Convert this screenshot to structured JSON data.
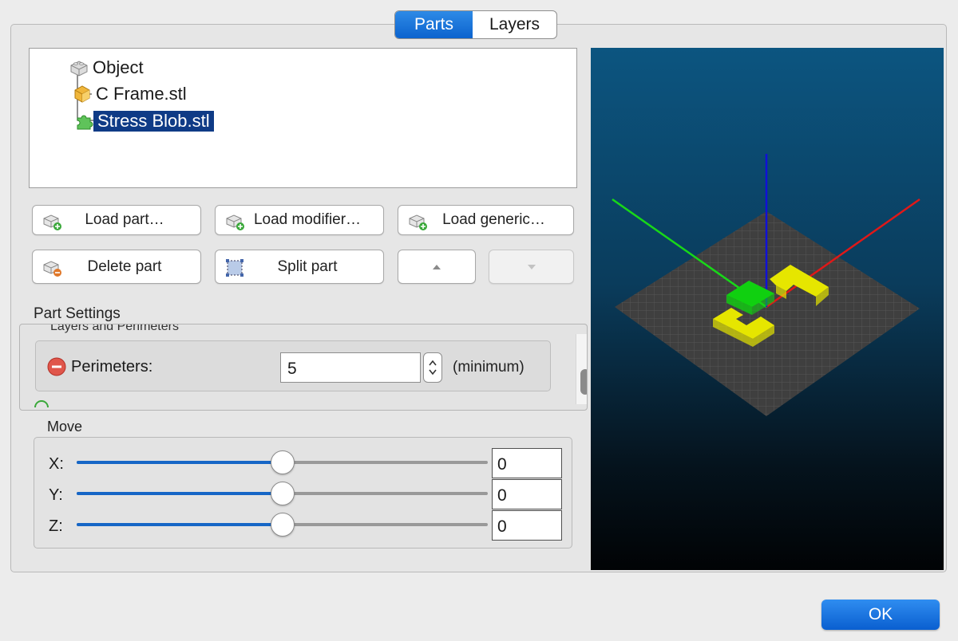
{
  "tabs": [
    {
      "label": "Parts",
      "active": true
    },
    {
      "label": "Layers",
      "active": false
    }
  ],
  "tree": {
    "root": "Object",
    "items": [
      {
        "label": "C Frame.stl",
        "icon": "package-icon"
      },
      {
        "label": "Stress Blob.stl",
        "icon": "puzzle-icon",
        "selected": true
      }
    ]
  },
  "buttons": {
    "load_part": "Load part…",
    "load_modifier": "Load modifier…",
    "load_generic": "Load generic…",
    "delete_part": "Delete part",
    "split_part": "Split part"
  },
  "part_settings": {
    "title": "Part Settings",
    "group_title": "Layers and Perimeters",
    "option_label": "Perimeters:",
    "option_value": "5",
    "option_suffix": "(minimum)"
  },
  "move": {
    "title": "Move",
    "axes": [
      {
        "label": "X:",
        "value": "0",
        "slider_fraction": 0.5
      },
      {
        "label": "Y:",
        "value": "0",
        "slider_fraction": 0.5
      },
      {
        "label": "Z:",
        "value": "0",
        "slider_fraction": 0.5
      }
    ]
  },
  "footer": {
    "ok_label": "OK"
  },
  "colors": {
    "accent": "#0c63ce",
    "selection": "#0f3b86",
    "x_axis": "#e01818",
    "y_axis": "#18d818",
    "z_axis": "#1010d8",
    "part_frame": "#e6e600",
    "part_blob": "#10d010"
  }
}
